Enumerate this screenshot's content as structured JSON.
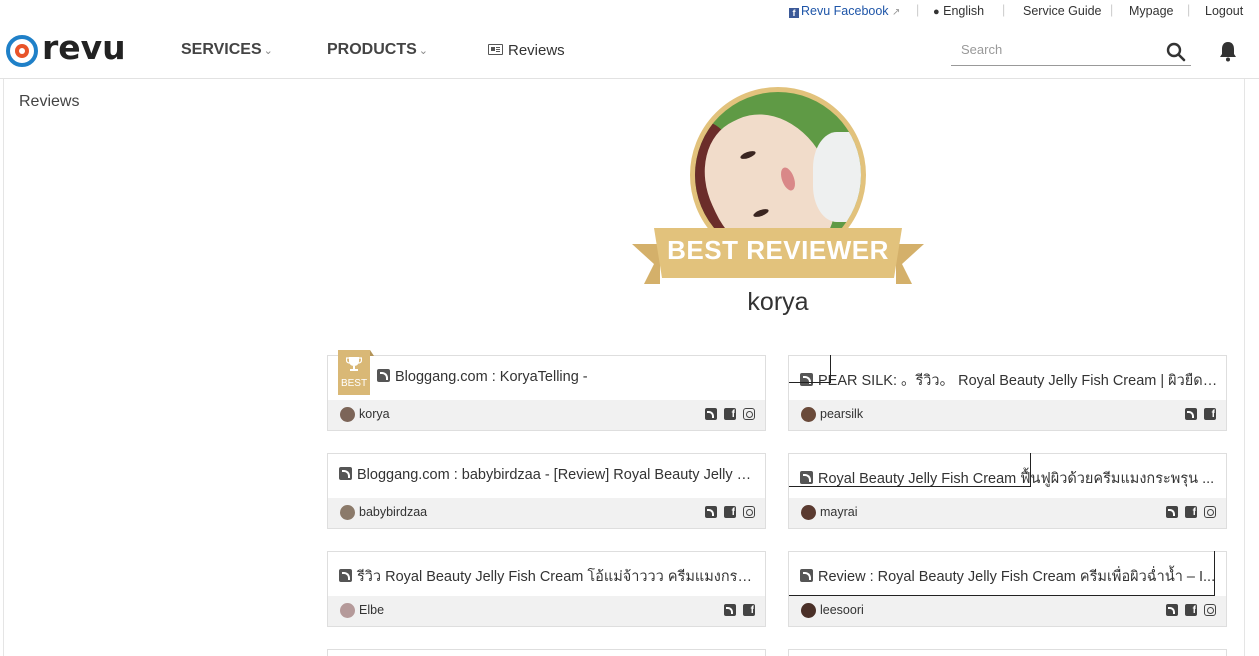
{
  "topbar": {
    "facebook": "Revu Facebook",
    "language": "English",
    "service_guide": "Service Guide",
    "mypage": "Mypage",
    "logout": "Logout",
    "separator": "|"
  },
  "header": {
    "logo": "revu",
    "nav": {
      "services": "SERVICES",
      "products": "PRODUCTS",
      "reviews": "Reviews"
    },
    "search_placeholder": "Search"
  },
  "sidebar": {
    "title": "Reviews"
  },
  "profile": {
    "badge": "BEST REVIEWER",
    "username": "korya"
  },
  "colors": {
    "accent_gold": "#e2c27c",
    "logo_blue": "#1f80c8",
    "logo_orange": "#e8542a"
  },
  "reviews": [
    {
      "title": "Bloggang.com : KoryaTelling -",
      "user": "korya",
      "best": true,
      "best_label": "BEST",
      "socials": [
        "rss",
        "facebook",
        "instagram"
      ]
    },
    {
      "title": "PEAR SILK: 。รีวิว。 Royal Beauty Jelly Fish Cream | ผิวยืดหยุ่นกระชับ...",
      "user": "pearsilk",
      "best": false,
      "socials": [
        "rss",
        "facebook"
      ]
    },
    {
      "title": "Bloggang.com : babybirdzaa - [Review] Royal Beauty Jelly Fish Cream...",
      "user": "babybirdzaa",
      "best": false,
      "socials": [
        "rss",
        "facebook",
        "instagram"
      ]
    },
    {
      "title": "Royal Beauty Jelly Fish Cream ฟื้นฟูผิวด้วยครีมแมงกระพรุน ...",
      "user": "mayrai",
      "best": false,
      "socials": [
        "rss",
        "facebook",
        "instagram"
      ]
    },
    {
      "title": "รีวิว Royal Beauty Jelly Fish Cream โอ้แม่จ้าววว ครีมแมงกระพรุนที่...",
      "user": "Elbe",
      "best": false,
      "socials": [
        "rss",
        "facebook"
      ]
    },
    {
      "title": "Review : Royal Beauty Jelly Fish Cream ครีมเพื่อผิวฉ่ำน้ำ – I...",
      "user": "leesoori",
      "best": false,
      "socials": [
        "rss",
        "facebook",
        "instagram"
      ]
    }
  ]
}
